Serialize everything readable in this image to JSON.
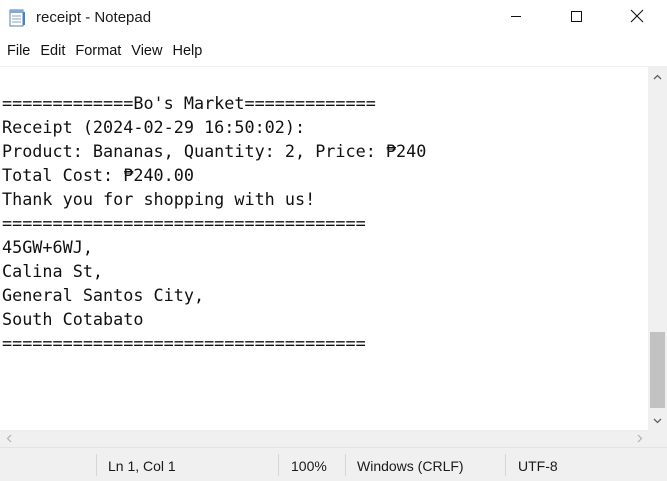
{
  "window": {
    "title": "receipt - Notepad",
    "minimize_label": "minimize",
    "maximize_label": "maximize",
    "close_label": "close"
  },
  "menu": {
    "items": [
      "File",
      "Edit",
      "Format",
      "View",
      "Help"
    ]
  },
  "document": {
    "lines": [
      "=============Bo's Market=============",
      "Receipt (2024-02-29 16:50:02):",
      "Product: Bananas, Quantity: 2, Price: ₱240",
      "Total Cost: ₱240.00",
      "Thank you for shopping with us!",
      "====================================",
      "45GW+6WJ,",
      "Calina St,",
      "General Santos City,",
      "South Cotabato",
      "===================================="
    ]
  },
  "status": {
    "position": "Ln 1, Col 1",
    "zoom": "100%",
    "line_ending": "Windows (CRLF)",
    "encoding": "UTF-8"
  },
  "icons": {
    "app": "notepad-icon",
    "minimize": "minimize-icon",
    "maximize": "maximize-icon",
    "close": "close-icon",
    "scroll_up": "chevron-up-icon",
    "scroll_down": "chevron-down-icon",
    "scroll_left": "chevron-left-icon",
    "scroll_right": "chevron-right-icon"
  }
}
